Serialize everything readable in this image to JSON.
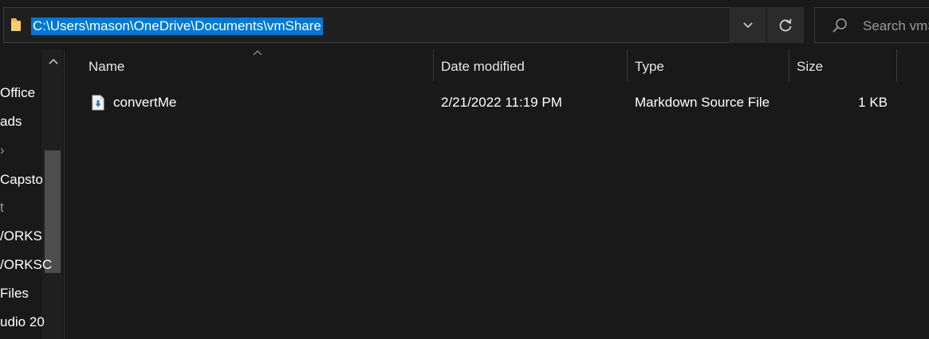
{
  "address_bar": {
    "path": "C:\\Users\\mason\\OneDrive\\Documents\\vmShare",
    "folder_icon": "folder-icon",
    "dropdown_icon": "chevron-down-icon",
    "refresh_icon": "refresh-icon"
  },
  "search": {
    "placeholder": "Search vmS",
    "icon": "search-icon"
  },
  "nav": {
    "items": [
      {
        "label": "Office"
      },
      {
        "label": "ads"
      },
      {
        "label": "›"
      },
      {
        "label": "Capsto"
      },
      {
        "label": "t"
      },
      {
        "label": "/ORKS"
      },
      {
        "label": "/ORKSC"
      },
      {
        "label": "Files"
      },
      {
        "label": "udio 20"
      }
    ]
  },
  "columns": {
    "name": "Name",
    "date_modified": "Date modified",
    "type": "Type",
    "size": "Size"
  },
  "files": [
    {
      "name": "convertMe",
      "date_modified": "2/21/2022 11:19 PM",
      "type": "Markdown Source File",
      "size": "1 KB",
      "icon": "markdown-file-icon"
    }
  ],
  "colors": {
    "background": "#191919",
    "selection": "#0078d7"
  }
}
